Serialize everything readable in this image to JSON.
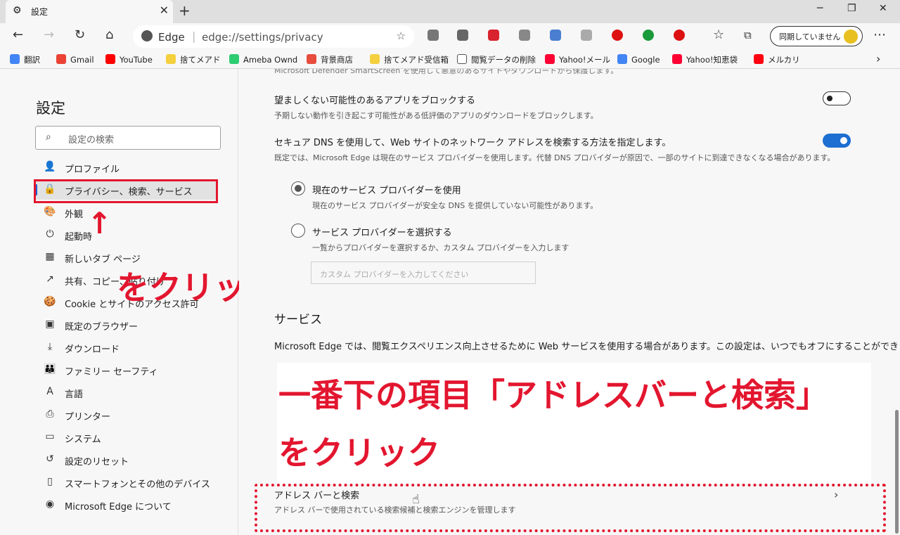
{
  "tab": {
    "title": "設定",
    "close": "✕",
    "new": "+"
  },
  "window": {
    "minimize": "─",
    "maximize": "❐",
    "close": "✕"
  },
  "address": {
    "site_label": "Edge",
    "separator": "|",
    "url": "edge://settings/privacy"
  },
  "sync": {
    "label": "同期していません"
  },
  "bookmarks": [
    {
      "label": "翻訳",
      "color": "#4285f4"
    },
    {
      "label": "Gmail",
      "color": "#ea4335"
    },
    {
      "label": "YouTube",
      "color": "#ff0000"
    },
    {
      "label": "捨てメアド",
      "color": "#f4d03f"
    },
    {
      "label": "Ameba Ownd",
      "color": "#2ecc71"
    },
    {
      "label": "背景商店",
      "color": "#e74c3c"
    },
    {
      "label": "捨てメアド受信箱",
      "color": "#f4d03f"
    },
    {
      "label": "閲覧データの削除",
      "color": "#ffffff"
    },
    {
      "label": "Yahoo!メール",
      "color": "#ff0033"
    },
    {
      "label": "Google",
      "color": "#4285f4"
    },
    {
      "label": "Yahoo!知恵袋",
      "color": "#ff0033"
    },
    {
      "label": "メルカリ",
      "color": "#ff0211"
    }
  ],
  "sidebar": {
    "title": "設定",
    "search_placeholder": "設定の検索",
    "items": [
      {
        "label": "プロファイル",
        "icon": "👤"
      },
      {
        "label": "プライバシー、検索、サービス",
        "icon": "🔒"
      },
      {
        "label": "外観",
        "icon": "🎨"
      },
      {
        "label": "起動時",
        "icon": "⏻"
      },
      {
        "label": "新しいタブ ページ",
        "icon": "▦"
      },
      {
        "label": "共有、コピー、貼り付け",
        "icon": "↗"
      },
      {
        "label": "Cookie とサイトのアクセス許可",
        "icon": "🍪"
      },
      {
        "label": "既定のブラウザー",
        "icon": "▣"
      },
      {
        "label": "ダウンロード",
        "icon": "⤓"
      },
      {
        "label": "ファミリー セーフティ",
        "icon": "👪"
      },
      {
        "label": "言語",
        "icon": "A"
      },
      {
        "label": "プリンター",
        "icon": "⎙"
      },
      {
        "label": "システム",
        "icon": "▭"
      },
      {
        "label": "設定のリセット",
        "icon": "↺"
      },
      {
        "label": "スマートフォンとその他のデバイス",
        "icon": "▯"
      },
      {
        "label": "Microsoft Edge について",
        "icon": "◉"
      }
    ]
  },
  "main": {
    "top_fade": "Microsoft Defender SmartScreen を使用して悪意のあるサイトやダウンロードから保護します。",
    "block_apps": {
      "title": "望ましくない可能性のあるアプリをブロックする",
      "desc": "予期しない動作を引き起こす可能性がある低評価のアプリのダウンロードをブロックします。",
      "state": "off"
    },
    "secure_dns": {
      "title": "セキュア DNS を使用して、Web サイトのネットワーク アドレスを検索する方法を指定します。",
      "desc": "既定では、Microsoft Edge は現在のサービス プロバイダーを使用します。代替 DNS プロバイダーが原因で、一部のサイトに到達できなくなる場合があります。",
      "state": "on"
    },
    "radio_current": {
      "title": "現在のサービス プロバイダーを使用",
      "desc": "現在のサービス プロバイダーが安全な DNS を提供していない可能性があります。"
    },
    "radio_choose": {
      "title": "サービス プロバイダーを選択する",
      "desc": "一覧からプロバイダーを選択するか、カスタム プロバイダーを入力します"
    },
    "custom_placeholder": "カスタム プロバイダーを入力してください",
    "services_heading": "サービス",
    "services_desc": "Microsoft Edge では、閲覧エクスペリエンス向上させるために Web サービスを使用する場合があります。この設定は、いつでもオフにすることができます。",
    "address_bar_item": {
      "title": "アドレス バーと検索",
      "desc": "アドレス バーで使用されている検索候補と検索エンジンを管理します"
    }
  },
  "annotations": {
    "arrow": "↑",
    "click1": "をクリック",
    "line2a": "一番下の項目「アドレスバーと検索」",
    "line2b": "をクリック"
  }
}
